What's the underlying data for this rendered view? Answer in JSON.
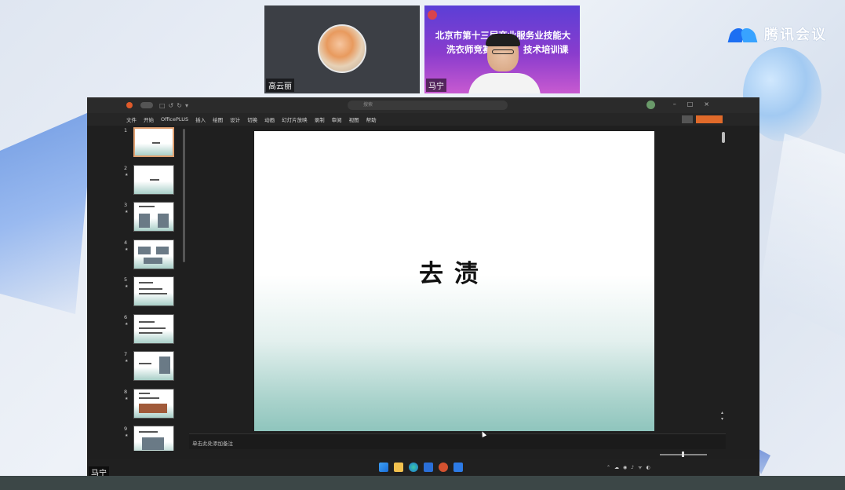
{
  "meeting": {
    "brand": "腾讯会议",
    "participants": [
      {
        "name": "高云丽"
      },
      {
        "name": "马宁"
      }
    ],
    "banner": {
      "line1": "北京市第十三届商业服务业技能大赛",
      "line2a": "洗衣师竞赛",
      "line2b": "技术培训课"
    },
    "screen_share_owner": "马宁"
  },
  "ppt": {
    "search_placeholder": "搜索",
    "ribbon_tabs": [
      "文件",
      "开始",
      "OfficePLUS",
      "插入",
      "绘图",
      "设计",
      "切换",
      "动画",
      "幻灯片放映",
      "录制",
      "审阅",
      "视图",
      "帮助"
    ],
    "slide_count_visible": 9,
    "current_slide": 1,
    "current_slide_title": "去渍",
    "notes_placeholder": "单击此处添加备注"
  },
  "colors": {
    "window_bg": "#1f1f1f",
    "slide_gradient_bottom": "#8fc5bd",
    "accent_orange": "#e06a2a",
    "banner_purple": "#5b3fd6"
  },
  "icons": [
    "meeting-logo-icon",
    "search-icon",
    "windows-start-icon",
    "file-explorer-icon",
    "edge-icon",
    "store-icon",
    "powerpoint-icon",
    "chat-icon",
    "wifi-icon",
    "volume-icon"
  ]
}
